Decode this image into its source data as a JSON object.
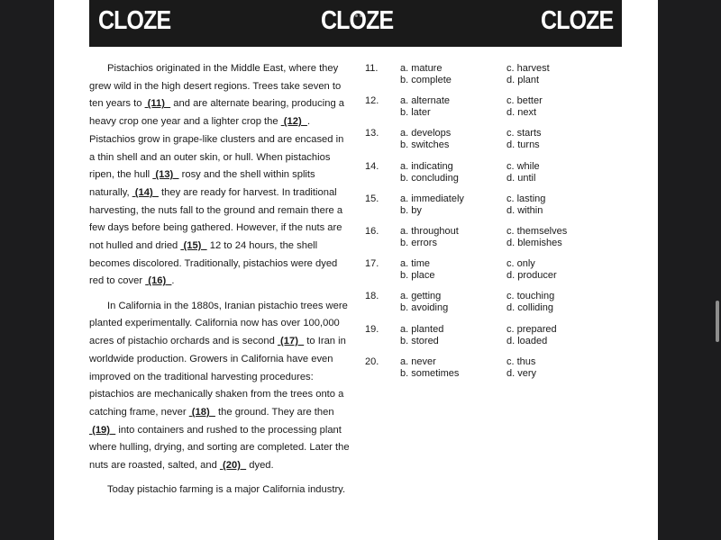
{
  "header": {
    "words": [
      "CLOZE",
      "CLOZE",
      "CLOZE"
    ]
  },
  "passage": {
    "paragraphs": [
      [
        {
          "t": "Pistachios originated in the Middle East, where they grew wild in the high desert regions. Trees take seven to ten years to "
        },
        {
          "blank": "(11)"
        },
        {
          "t": " and are alternate bearing, producing a heavy crop one year and a lighter crop the "
        },
        {
          "blank": "(12)"
        },
        {
          "t": ". Pistachios grow in grape-like clusters and are encased in a thin shell and an outer skin, or hull. When pistachios ripen, the hull "
        },
        {
          "blank": "(13)"
        },
        {
          "t": " rosy and the shell within splits naturally, "
        },
        {
          "blank": "(14)"
        },
        {
          "t": " they are ready for harvest. In traditional harvesting, the nuts fall to the ground and remain there a few days before being gathered. However, if the nuts are not hulled and dried "
        },
        {
          "blank": "(15)"
        },
        {
          "t": " 12 to 24 hours, the shell becomes discolored. Traditionally, pistachios were dyed red to cover "
        },
        {
          "blank": "(16)"
        },
        {
          "t": "."
        }
      ],
      [
        {
          "t": "In California in the 1880s, Iranian pistachio trees were planted experimentally. California now has over 100,000 acres of pistachio orchards and is second "
        },
        {
          "blank": "(17)"
        },
        {
          "t": " to Iran in worldwide production. Growers in California have even improved on the traditional harvesting procedures: pistachios are mechanically shaken from the trees onto a catching frame, never "
        },
        {
          "blank": "(18)"
        },
        {
          "t": " the ground. They are then "
        },
        {
          "blank": "(19)"
        },
        {
          "t": " into containers and rushed to the processing plant where hulling, drying, and sorting are completed. Later the nuts are roasted, salted, and "
        },
        {
          "blank": "(20)"
        },
        {
          "t": " dyed."
        }
      ],
      [
        {
          "t": "Today pistachio farming is a major California industry."
        }
      ]
    ]
  },
  "questions": [
    {
      "num": "11.",
      "a": "a. mature",
      "b": "b. complete",
      "c": "c. harvest",
      "d": "d. plant"
    },
    {
      "num": "12.",
      "a": "a. alternate",
      "b": "b. later",
      "c": "c. better",
      "d": "d. next"
    },
    {
      "num": "13.",
      "a": "a. develops",
      "b": "b. switches",
      "c": "c. starts",
      "d": "d. turns"
    },
    {
      "num": "14.",
      "a": "a. indicating",
      "b": "b. concluding",
      "c": "c. while",
      "d": "d. until"
    },
    {
      "num": "15.",
      "a": "a. immediately",
      "b": "b. by",
      "c": "c. lasting",
      "d": "d. within"
    },
    {
      "num": "16.",
      "a": "a. throughout",
      "b": "b. errors",
      "c": "c. themselves",
      "d": "d. blemishes"
    },
    {
      "num": "17.",
      "a": "a. time",
      "b": "b. place",
      "c": "c. only",
      "d": "d. producer"
    },
    {
      "num": "18.",
      "a": "a. getting",
      "b": "b. avoiding",
      "c": "c. touching",
      "d": "d. colliding"
    },
    {
      "num": "19.",
      "a": "a. planted",
      "b": "b. stored",
      "c": "c. prepared",
      "d": "d. loaded"
    },
    {
      "num": "20.",
      "a": "a. never",
      "b": "b. sometimes",
      "c": "c. thus",
      "d": "d. very"
    }
  ],
  "colors": {
    "background": "#1c1c1e",
    "page": "#ffffff",
    "header_bar": "#1a1a1a",
    "text": "#1a1a1a"
  }
}
